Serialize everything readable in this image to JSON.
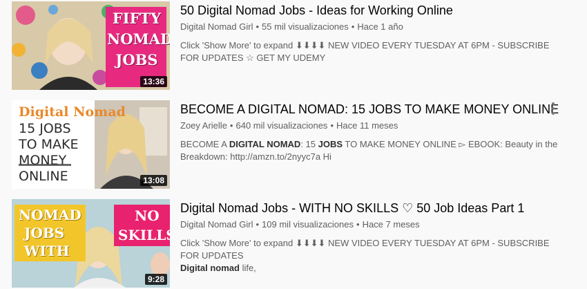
{
  "results": [
    {
      "title": "50 Digital Nomad Jobs - Ideas for Working Online",
      "channel": "Digital Nomad Girl",
      "views": "55 mil visualizaciones",
      "age": "Hace 1 año",
      "description": "Click 'Show More' to expand ⬇⬇⬇⬇ NEW VIDEO EVERY TUESDAY AT 6PM - SUBSCRIBE FOR UPDATES ☆ GET MY UDEMY",
      "duration": "13:36",
      "thumb_text": [
        "FIFTY",
        "NOMAD",
        "JOBS"
      ],
      "separator": "•"
    },
    {
      "title": "BECOME A DIGITAL NOMAD: 15 JOBS TO MAKE MONEY ONLINE",
      "channel": "Zoey Arielle",
      "views": "640 mil visualizaciones",
      "age": "Hace 11 meses",
      "desc_parts": [
        "BECOME A ",
        "DIGITAL NOMAD",
        ": 15 ",
        "JOBS",
        " TO MAKE MONEY ONLINE ▻ EBOOK: Beauty in the Breakdown: http://amzn.to/2nyyc7a Hi"
      ],
      "duration": "13:08",
      "thumb_text": [
        "Digital Nomad",
        "15 JOBS",
        "TO MAKE",
        "MONEY",
        "ONLINE"
      ],
      "separator": "•"
    },
    {
      "title": "Digital Nomad Jobs - WITH NO SKILLS ♡ 50 Job Ideas Part 1",
      "channel": "Digital Nomad Girl",
      "views": "109 mil visualizaciones",
      "age": "Hace 7 meses",
      "desc_line1": "Click 'Show More' to expand ⬇⬇⬇⬇ NEW VIDEO EVERY TUESDAY AT 6PM - SUBSCRIBE FOR UPDATES",
      "desc_bold": "Digital nomad",
      "desc_tail": " life,",
      "duration": "9:28",
      "thumb_text": [
        "NOMAD",
        "JOBS",
        "WITH",
        "NO",
        "SKILLS"
      ],
      "separator": "•"
    }
  ],
  "colors": {
    "background": "#f9f9f9",
    "title": "#030303",
    "meta": "#606060",
    "thumb1_pink": "#e8227d",
    "thumb2_orange": "#e8892a",
    "thumb3_yellow": "#f2c62a",
    "thumb3_pink": "#e8226e"
  },
  "icons": [
    "more-vert-icon"
  ]
}
